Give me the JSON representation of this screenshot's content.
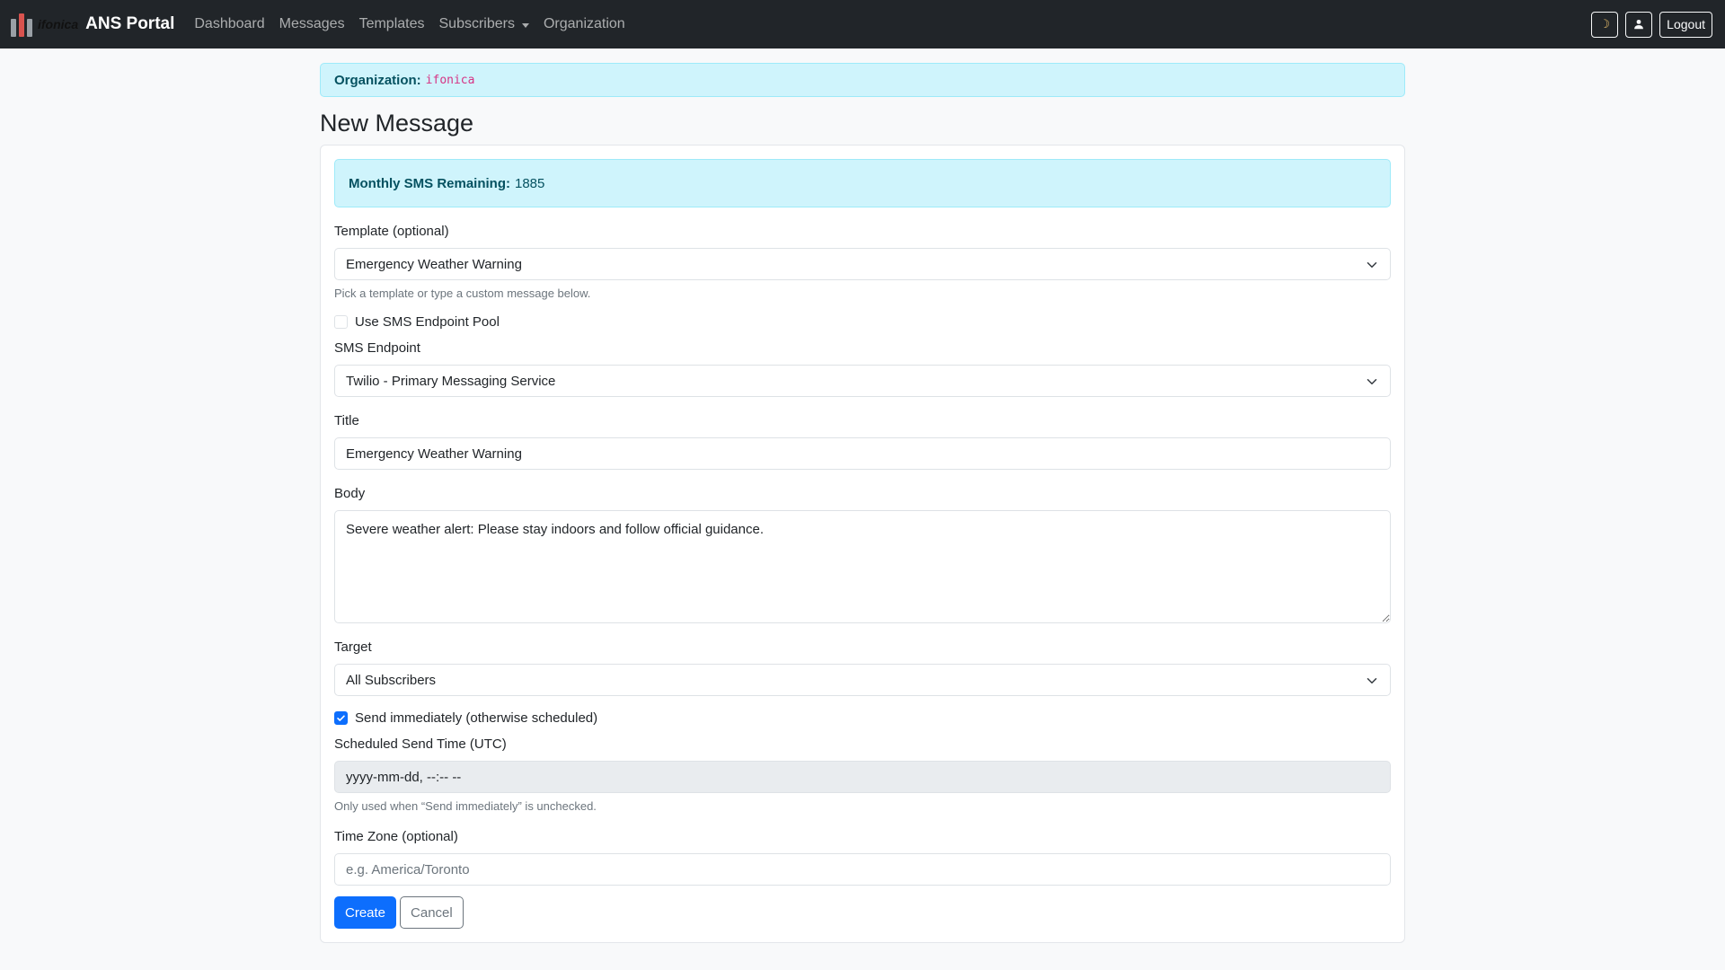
{
  "navbar": {
    "logo_text": "ifonica",
    "brand": "ANS Portal",
    "links": [
      "Dashboard",
      "Messages",
      "Templates",
      "Subscribers",
      "Organization"
    ],
    "theme_icon": "moon-icon",
    "profile_icon": "person-icon",
    "logout_label": "Logout"
  },
  "org_alert": {
    "label": "Organization:",
    "value": "ifonica"
  },
  "page_title": "New Message",
  "sms_alert": {
    "label": "Monthly SMS Remaining:",
    "value": "1885"
  },
  "form": {
    "template": {
      "label": "Template (optional)",
      "value": "Emergency Weather Warning",
      "help": "Pick a template or type a custom message below."
    },
    "use_pool": {
      "label": "Use SMS Endpoint Pool",
      "checked": false
    },
    "endpoint": {
      "label": "SMS Endpoint",
      "value": "Twilio - Primary Messaging Service"
    },
    "title": {
      "label": "Title",
      "value": "Emergency Weather Warning"
    },
    "body": {
      "label": "Body",
      "value": "Severe weather alert: Please stay indoors and follow official guidance."
    },
    "target": {
      "label": "Target",
      "value": "All Subscribers"
    },
    "send_immediately": {
      "label": "Send immediately (otherwise scheduled)",
      "checked": true
    },
    "scheduled": {
      "label": "Scheduled Send Time (UTC)",
      "value": "yyyy-mm-dd, --:-- --",
      "help": "Only used when “Send immediately” is unchecked."
    },
    "timezone": {
      "label": "Time Zone (optional)",
      "placeholder": "e.g. America/Toronto"
    },
    "create_label": "Create",
    "cancel_label": "Cancel"
  },
  "colors": {
    "navbar_bg": "#212529",
    "info_bg": "#cff4fc",
    "primary": "#0d6efd",
    "org_code": "#d63384"
  }
}
